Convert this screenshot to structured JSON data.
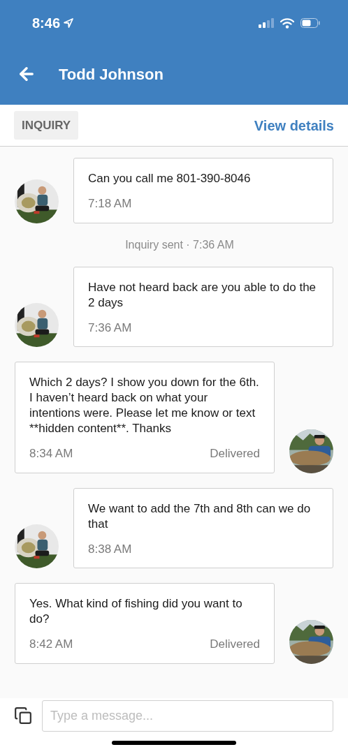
{
  "status_bar": {
    "time": "8:46"
  },
  "header": {
    "title": "Todd Johnson"
  },
  "info_bar": {
    "badge": "INQUIRY",
    "link": "View details"
  },
  "messages": [
    {
      "kind": "incoming",
      "text": "Can you call me 801-390-8046",
      "time": "7:18 AM"
    },
    {
      "kind": "system",
      "text": "Inquiry sent · 7:36 AM"
    },
    {
      "kind": "incoming",
      "text": "Have not heard back are you able to do the 2 days",
      "time": "7:36 AM"
    },
    {
      "kind": "outgoing",
      "text": "Which 2 days?  I show you down for the 6th.  I haven’t heard back on what your intentions were. Please let me know or text **hidden content**. Thanks",
      "time": "8:34 AM",
      "status": "Delivered"
    },
    {
      "kind": "incoming",
      "text": "We want to add the 7th and 8th can we do that",
      "time": "8:38 AM"
    },
    {
      "kind": "outgoing",
      "text": "Yes.  What kind of fishing did you want to do?",
      "time": "8:42 AM",
      "status": "Delivered"
    }
  ],
  "composer": {
    "placeholder": "Type a message..."
  }
}
